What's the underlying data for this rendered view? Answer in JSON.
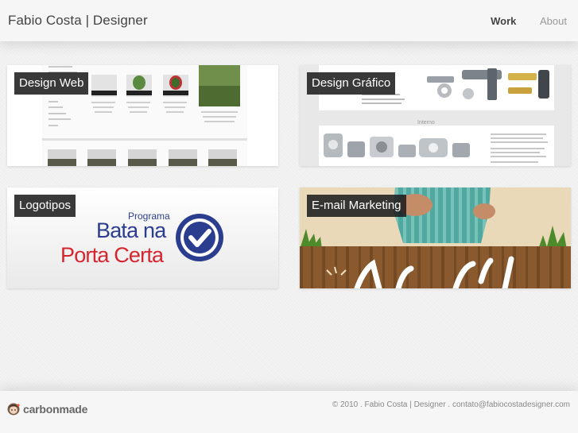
{
  "header": {
    "title": "Fabio Costa | Designer",
    "nav": [
      {
        "label": "Work"
      },
      {
        "label": "About"
      }
    ]
  },
  "projects": [
    {
      "label": "Design Web"
    },
    {
      "label": "Design Gráfico",
      "inner_heading": "Interno"
    },
    {
      "label": "Logotipos",
      "logo_small": "Programa",
      "logo_line1": "Bata na",
      "logo_line2": "Porta Certa"
    },
    {
      "label": "E-mail Marketing"
    }
  ],
  "footer": {
    "brand": "carbonmade",
    "copyright": "© 2010 . Fabio Costa | Designer . contato@fabiocostadesigner.com"
  },
  "colors": {
    "logo_blue": "#2b3d8f",
    "logo_red": "#d6252f",
    "shirt_teal": "#4fa9a1",
    "plant_green": "#4d8b2a"
  }
}
